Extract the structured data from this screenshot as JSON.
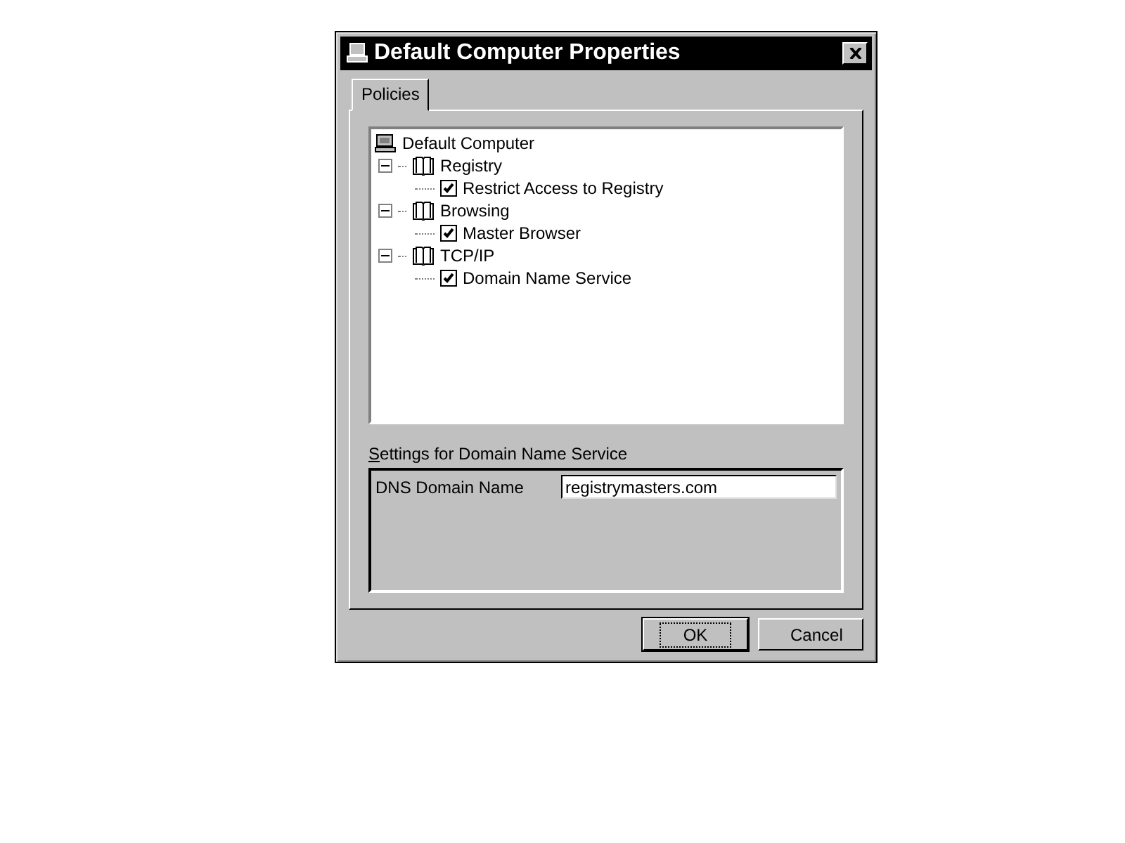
{
  "window": {
    "title": "Default Computer Properties"
  },
  "tabs": [
    {
      "label": "Policies",
      "selected": true
    }
  ],
  "tree": {
    "label": "Default Computer",
    "children": [
      {
        "label": "Registry",
        "expanded": true,
        "children": [
          {
            "label": "Restrict Access to Registry",
            "checked": true
          }
        ]
      },
      {
        "label": "Browsing",
        "expanded": true,
        "children": [
          {
            "label": "Master Browser",
            "checked": true
          }
        ]
      },
      {
        "label": "TCP/IP",
        "expanded": true,
        "children": [
          {
            "label": "Domain Name Service",
            "checked": true
          }
        ]
      }
    ]
  },
  "settings": {
    "title": "Settings for Domain Name Service",
    "fields": [
      {
        "label": "DNS Domain Name",
        "value": "registrymasters.com"
      }
    ]
  },
  "buttons": [
    {
      "label": "OK",
      "default": true
    },
    {
      "label": "Cancel",
      "default": false
    }
  ]
}
